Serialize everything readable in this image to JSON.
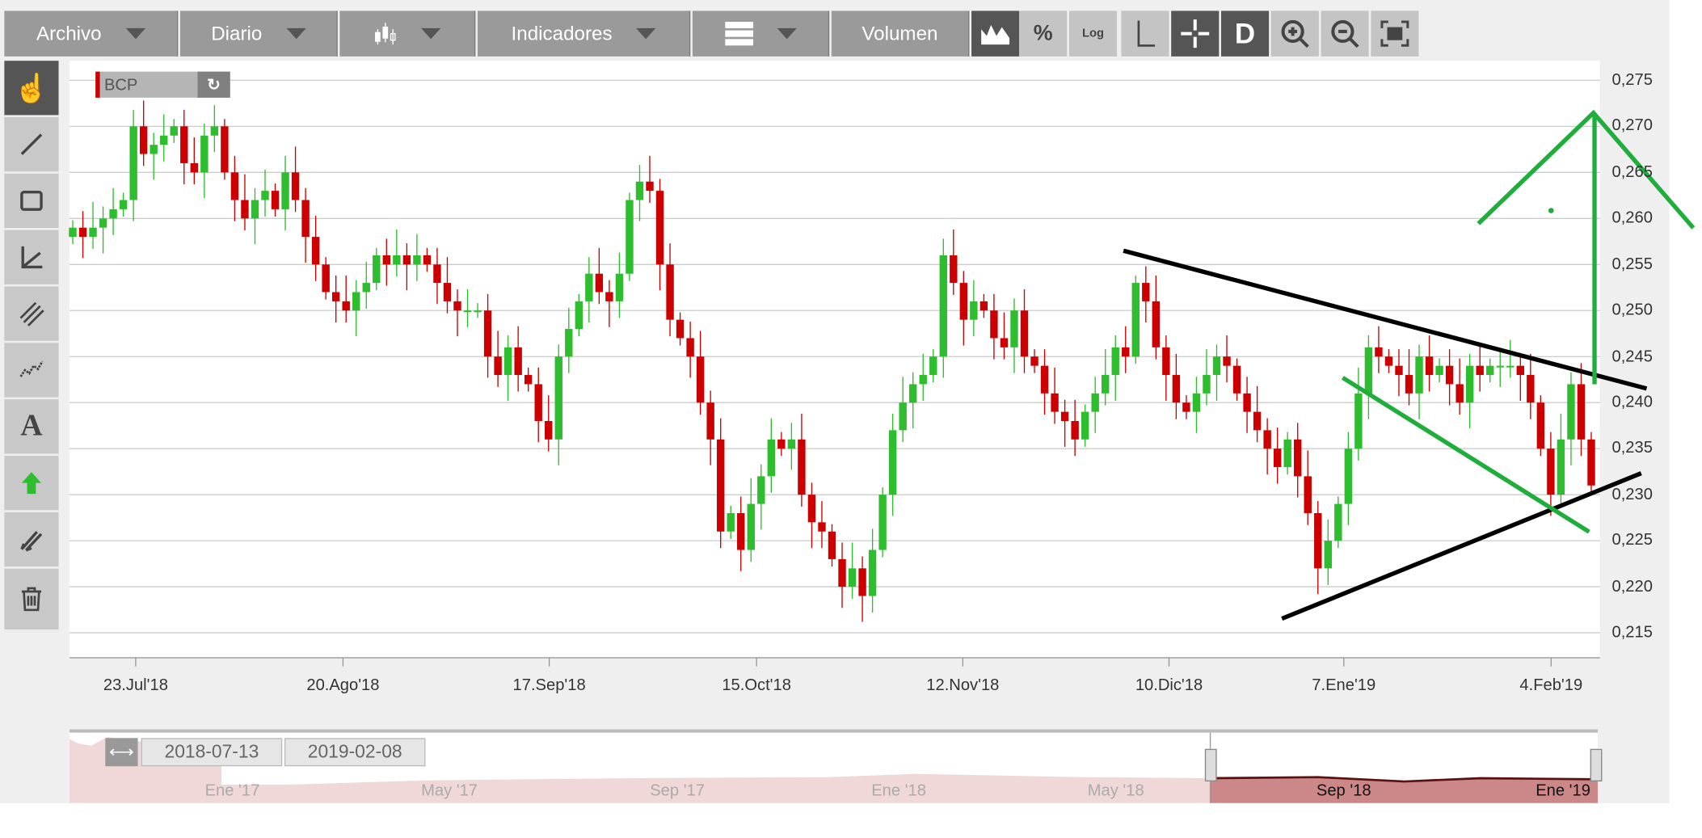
{
  "toolbar": {
    "archivo": "Archivo",
    "diario": "Diario",
    "indicadores": "Indicadores",
    "volumen": "Volumen",
    "percent": "%",
    "log": "Log",
    "d": "D"
  },
  "legend": {
    "symbol": "BCP"
  },
  "navigator": {
    "from": "2018-07-13",
    "to": "2019-02-08",
    "labels": [
      "Ene '17",
      "May '17",
      "Sep '17",
      "Ene '18",
      "May '18",
      "Sep '18",
      "Ene '19"
    ]
  },
  "left_tools": [
    "pointer",
    "line",
    "rectangle",
    "angle",
    "parallel-lines",
    "zigzag",
    "text",
    "arrow",
    "pencils",
    "trash"
  ],
  "left_tools_text": {
    "text": "A"
  },
  "colors": {
    "up": "#2ebd2e",
    "down": "#cc0000",
    "trendline_black": "#000000",
    "trendline_green": "#1fae3c"
  },
  "chart_data": {
    "type": "candlestick",
    "symbol": "BCP",
    "y_ticks": [
      "0,275",
      "0,270",
      "0,265",
      "0,260",
      "0,255",
      "0,250",
      "0,245",
      "0,240",
      "0,235",
      "0,230",
      "0,225",
      "0,220",
      "0,215"
    ],
    "ylim": [
      0.215,
      0.275
    ],
    "x_ticks": [
      "23.Jul'18",
      "20.Ago'18",
      "17.Sep'18",
      "15.Oct'18",
      "12.Nov'18",
      "10.Dic'18",
      "7.Ene'19",
      "4.Feb'19"
    ],
    "first_open": 0.258,
    "closes": [
      0.259,
      0.258,
      0.259,
      0.26,
      0.261,
      0.262,
      0.27,
      0.267,
      0.268,
      0.269,
      0.27,
      0.266,
      0.265,
      0.269,
      0.27,
      0.265,
      0.262,
      0.26,
      0.262,
      0.263,
      0.261,
      0.265,
      0.262,
      0.258,
      0.255,
      0.252,
      0.251,
      0.25,
      0.252,
      0.253,
      0.256,
      0.255,
      0.256,
      0.255,
      0.256,
      0.255,
      0.253,
      0.251,
      0.25,
      0.25,
      0.25,
      0.245,
      0.243,
      0.246,
      0.243,
      0.242,
      0.238,
      0.236,
      0.245,
      0.248,
      0.251,
      0.254,
      0.252,
      0.251,
      0.254,
      0.262,
      0.264,
      0.263,
      0.255,
      0.249,
      0.247,
      0.245,
      0.24,
      0.236,
      0.226,
      0.228,
      0.224,
      0.229,
      0.232,
      0.236,
      0.235,
      0.236,
      0.23,
      0.227,
      0.226,
      0.223,
      0.22,
      0.222,
      0.219,
      0.224,
      0.23,
      0.237,
      0.24,
      0.242,
      0.243,
      0.245,
      0.256,
      0.253,
      0.249,
      0.251,
      0.25,
      0.247,
      0.246,
      0.25,
      0.245,
      0.244,
      0.241,
      0.239,
      0.238,
      0.236,
      0.239,
      0.241,
      0.243,
      0.246,
      0.245,
      0.253,
      0.251,
      0.246,
      0.243,
      0.24,
      0.239,
      0.241,
      0.243,
      0.245,
      0.244,
      0.241,
      0.239,
      0.237,
      0.235,
      0.233,
      0.236,
      0.232,
      0.228,
      0.222,
      0.225,
      0.229,
      0.235,
      0.241,
      0.246,
      0.245,
      0.244,
      0.243,
      0.241,
      0.245,
      0.243,
      0.244,
      0.242,
      0.24,
      0.244,
      0.243,
      0.244,
      0.244,
      0.244,
      0.243,
      0.24,
      0.235,
      0.23,
      0.236,
      0.242,
      0.236,
      0.231
    ]
  }
}
